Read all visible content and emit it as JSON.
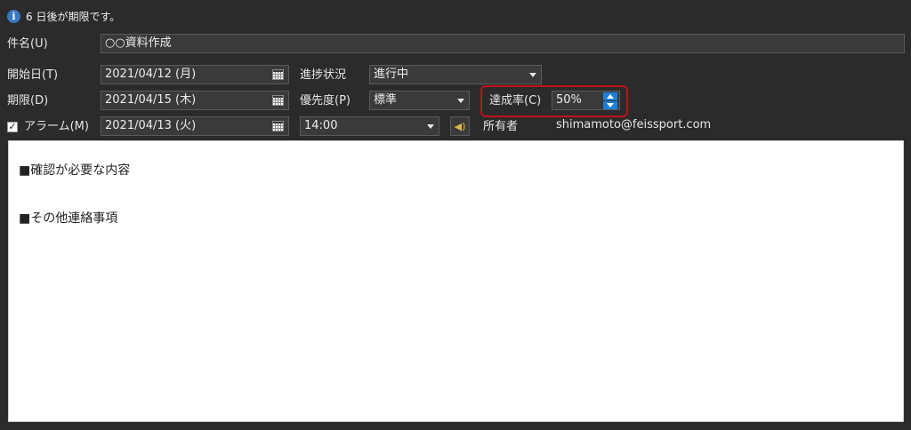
{
  "info": {
    "icon": "info-icon",
    "text": "6 日後が期限です。"
  },
  "subject": {
    "label": "件名(U)",
    "value": "○○資料作成"
  },
  "start_date": {
    "label": "開始日(T)",
    "value": "2021/04/12 (月)",
    "icon": "calendar-icon"
  },
  "due_date": {
    "label": "期限(D)",
    "value": "2021/04/15 (木)",
    "icon": "calendar-icon"
  },
  "alarm": {
    "label": "アラーム(M)",
    "checked": true,
    "date": "2021/04/13 (火)",
    "time": "14:00",
    "sound_icon": "speaker-icon"
  },
  "progress": {
    "label": "進捗状況",
    "value": "進行中"
  },
  "priority": {
    "label": "優先度(P)",
    "value": "標準"
  },
  "completion": {
    "label": "達成率(C)",
    "value": "50%",
    "highlight_color": "#c0121c"
  },
  "owner": {
    "label": "所有者",
    "value": "shimamoto@feissport.com"
  },
  "notes": {
    "lines": [
      "■確認が必要な内容",
      "■その他連絡事項"
    ]
  },
  "colors": {
    "background": "#2b2b2b",
    "spin_accent": "#1c7fd8",
    "info_icon": "#3a78c2"
  }
}
